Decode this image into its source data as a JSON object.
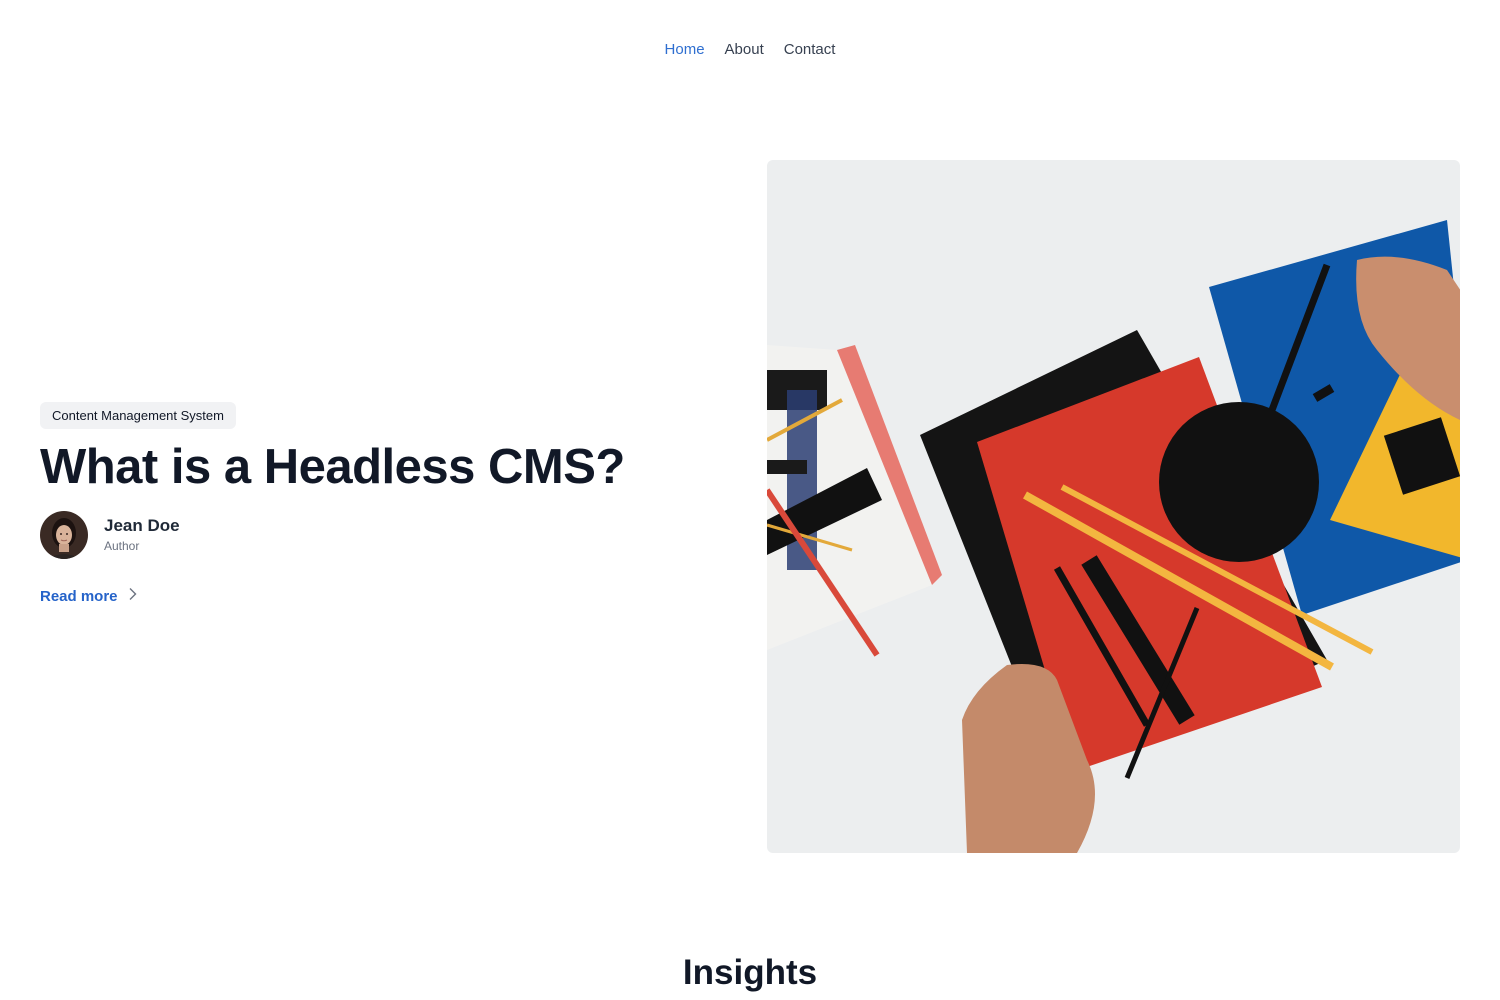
{
  "nav": {
    "items": [
      {
        "label": "Home",
        "active": true
      },
      {
        "label": "About",
        "active": false
      },
      {
        "label": "Contact",
        "active": false
      }
    ]
  },
  "hero": {
    "tag": "Content Management System",
    "title": "What is a Headless CMS?",
    "author": {
      "name": "Jean Doe",
      "role": "Author"
    },
    "read_more": "Read more"
  },
  "section": {
    "title": "Insights"
  },
  "colors": {
    "link": "#2f6fd0",
    "accent_blue": "#2563c9",
    "text": "#111827"
  }
}
